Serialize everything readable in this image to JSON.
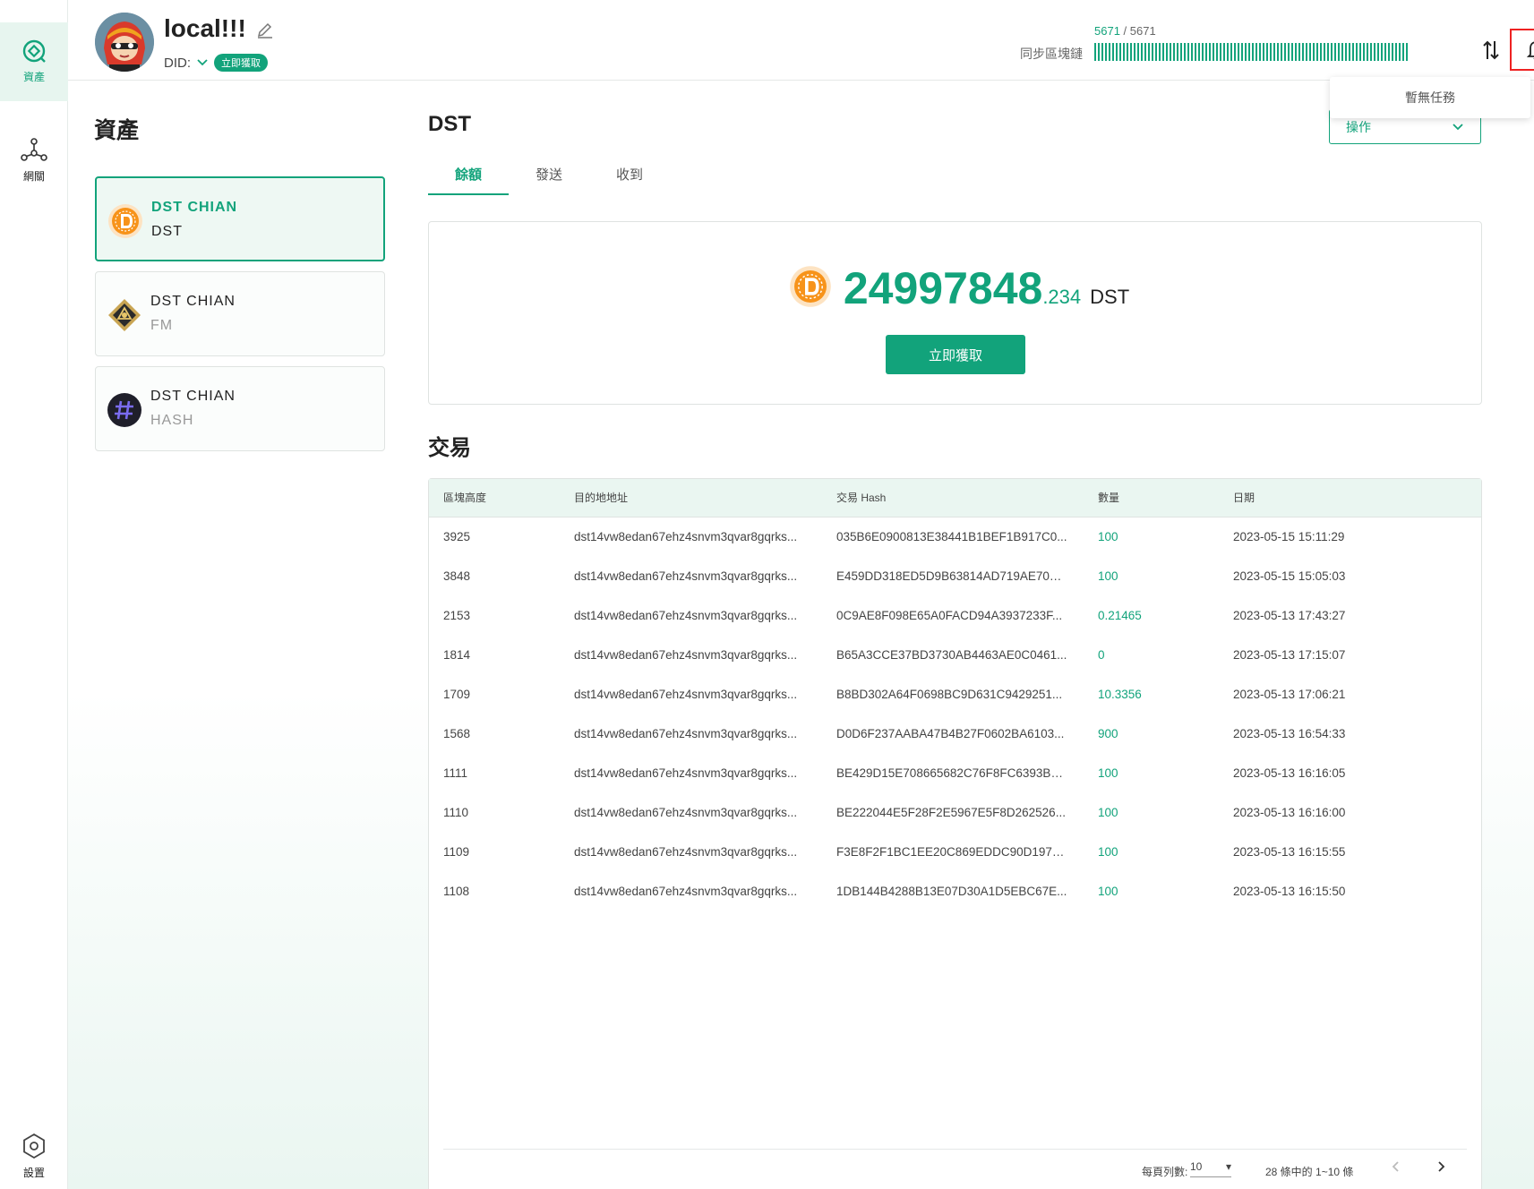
{
  "rail": {
    "items": [
      {
        "label": "資產",
        "active": true
      },
      {
        "label": "網關",
        "active": false
      }
    ],
    "settings_label": "設置"
  },
  "header": {
    "wallet_name": "local!!!",
    "did_label": "DID:",
    "did_badge": "立即獲取",
    "sync_label": "同步區塊鏈",
    "sync_current": "5671",
    "sync_sep": " / ",
    "sync_total": "5671",
    "sync_progress": 1.0,
    "notifications_empty": "暫無任務"
  },
  "assets": {
    "title": "資產",
    "items": [
      {
        "name": "DST CHIAN",
        "symbol": "DST",
        "active": true,
        "icon": "dst-coin-icon"
      },
      {
        "name": "DST CHIAN",
        "symbol": "FM",
        "active": false,
        "icon": "fm-coin-icon"
      },
      {
        "name": "DST CHIAN",
        "symbol": "HASH",
        "active": false,
        "icon": "hash-coin-icon"
      }
    ]
  },
  "coin": {
    "title": "DST",
    "ops_label": "操作",
    "tabs": [
      "餘額",
      "發送",
      "收到"
    ],
    "balance_int": "24997848",
    "balance_dec": ".234",
    "balance_unit": "DST",
    "claim_label": "立即獲取"
  },
  "transactions": {
    "title": "交易",
    "headers": [
      "區塊高度",
      "目的地地址",
      "交易 Hash",
      "數量",
      "日期"
    ],
    "rows": [
      [
        "3925",
        "dst14vw8edan67ehz4snvm3qvar8gqrks...",
        "035B6E0900813E38441B1BEF1B917C0...",
        "100",
        "2023-05-15 15:11:29"
      ],
      [
        "3848",
        "dst14vw8edan67ehz4snvm3qvar8gqrks...",
        "E459DD318ED5D9B63814AD719AE70D...",
        "100",
        "2023-05-15 15:05:03"
      ],
      [
        "2153",
        "dst14vw8edan67ehz4snvm3qvar8gqrks...",
        "0C9AE8F098E65A0FACD94A3937233F...",
        "0.21465",
        "2023-05-13 17:43:27"
      ],
      [
        "1814",
        "dst14vw8edan67ehz4snvm3qvar8gqrks...",
        "B65A3CCE37BD3730AB4463AE0C0461...",
        "0",
        "2023-05-13 17:15:07"
      ],
      [
        "1709",
        "dst14vw8edan67ehz4snvm3qvar8gqrks...",
        "B8BD302A64F0698BC9D631C9429251...",
        "10.3356",
        "2023-05-13 17:06:21"
      ],
      [
        "1568",
        "dst14vw8edan67ehz4snvm3qvar8gqrks...",
        "D0D6F237AABA47B4B27F0602BA6103...",
        "900",
        "2023-05-13 16:54:33"
      ],
      [
        "1111",
        "dst14vw8edan67ehz4snvm3qvar8gqrks...",
        "BE429D15E708665682C76F8FC6393BD...",
        "100",
        "2023-05-13 16:16:05"
      ],
      [
        "1110",
        "dst14vw8edan67ehz4snvm3qvar8gqrks...",
        "BE222044E5F28F2E5967E5F8D262526...",
        "100",
        "2023-05-13 16:16:00"
      ],
      [
        "1109",
        "dst14vw8edan67ehz4snvm3qvar8gqrks...",
        "F3E8F2F1BC1EE20C869EDDC90D1978...",
        "100",
        "2023-05-13 16:15:55"
      ],
      [
        "1108",
        "dst14vw8edan67ehz4snvm3qvar8gqrks...",
        "1DB144B4288B13E07D30A1D5EBC67E...",
        "100",
        "2023-05-13 16:15:50"
      ]
    ],
    "pager": {
      "rows_label": "每頁列數:",
      "rows_value": "10",
      "range_text": "28 條中的 1~10 條"
    }
  },
  "colors": {
    "accent": "#12a37b",
    "highlight_border": "#e22222"
  }
}
